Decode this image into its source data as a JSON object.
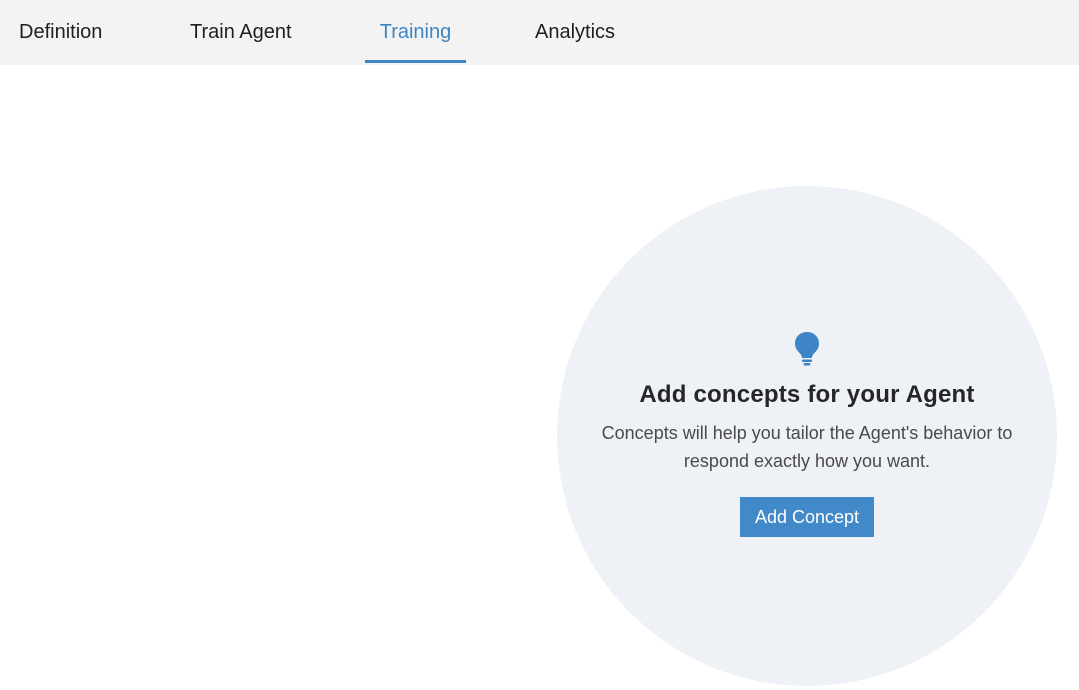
{
  "tabs": [
    {
      "label": "Definition",
      "active": false
    },
    {
      "label": "Train Agent",
      "active": false
    },
    {
      "label": "Training",
      "active": true
    },
    {
      "label": "Analytics",
      "active": false
    }
  ],
  "empty_state": {
    "icon": "lightbulb-icon",
    "title": "Add concepts for your Agent",
    "description": "Concepts will help you tailor the Agent's behavior to respond exactly how you want.",
    "button_label": "Add Concept"
  },
  "colors": {
    "accent": "#3d85c6",
    "button": "#4189c9",
    "tabbar_bg": "#f3f3f3",
    "circle_bg": "#eef1f5"
  }
}
